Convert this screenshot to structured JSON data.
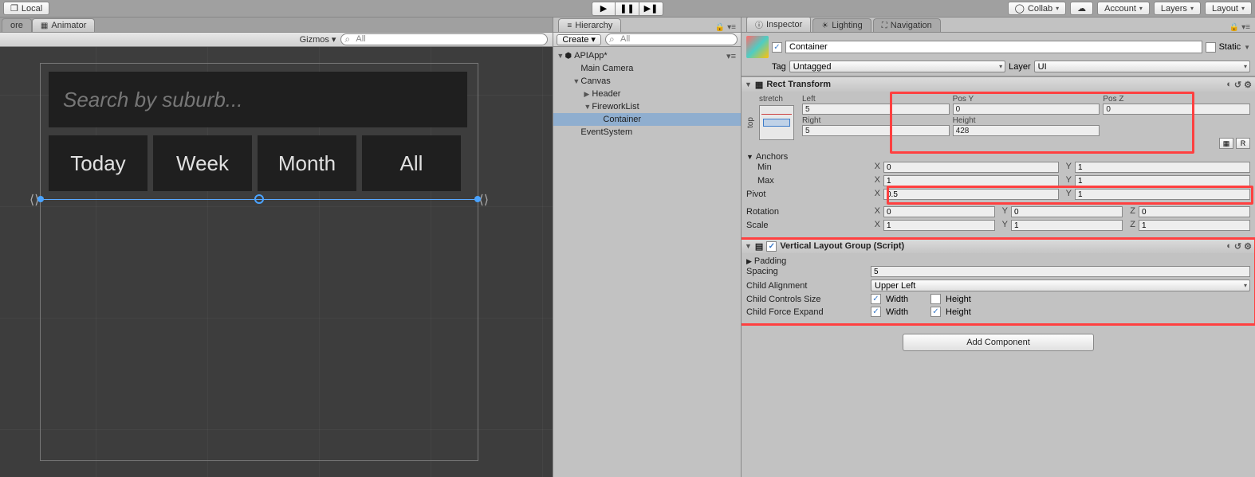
{
  "toolbar": {
    "local": "Local",
    "collab": "Collab",
    "account": "Account",
    "layers": "Layers",
    "layout": "Layout"
  },
  "scene": {
    "tabs": {
      "ore": "ore",
      "animator": "Animator"
    },
    "gizmos": "Gizmos",
    "search_placeholder": "All",
    "mock": {
      "search": "Search by suburb...",
      "btn_today": "Today",
      "btn_week": "Week",
      "btn_month": "Month",
      "btn_all": "All"
    }
  },
  "hierarchy": {
    "tab": "Hierarchy",
    "create": "Create",
    "search_placeholder": "All",
    "root": "APIApp*",
    "nodes": {
      "main_camera": "Main Camera",
      "canvas": "Canvas",
      "header": "Header",
      "fireworklist": "FireworkList",
      "container": "Container",
      "eventsystem": "EventSystem"
    }
  },
  "inspector": {
    "tabs": {
      "inspector": "Inspector",
      "lighting": "Lighting",
      "navigation": "Navigation"
    },
    "go_name": "Container",
    "static": "Static",
    "tag_label": "Tag",
    "tag_value": "Untagged",
    "layer_label": "Layer",
    "layer_value": "UI",
    "rect_transform": {
      "title": "Rect Transform",
      "stretch": "stretch",
      "top": "top",
      "left_label": "Left",
      "left": "5",
      "posy_label": "Pos Y",
      "posy": "0",
      "posz_label": "Pos Z",
      "posz": "0",
      "right_label": "Right",
      "right": "5",
      "height_label": "Height",
      "height": "428",
      "anchors": "Anchors",
      "min": "Min",
      "min_x": "0",
      "min_y": "1",
      "max": "Max",
      "max_x": "1",
      "max_y": "1",
      "pivot": "Pivot",
      "pivot_x": "0.5",
      "pivot_y": "1",
      "rotation": "Rotation",
      "rot_x": "0",
      "rot_y": "0",
      "rot_z": "0",
      "scale": "Scale",
      "scale_x": "1",
      "scale_y": "1",
      "scale_z": "1",
      "r_btn": "R"
    },
    "vlg": {
      "title": "Vertical Layout Group (Script)",
      "padding": "Padding",
      "spacing": "Spacing",
      "spacing_val": "5",
      "child_align": "Child Alignment",
      "child_align_val": "Upper Left",
      "ccs": "Child Controls Size",
      "cfe": "Child Force Expand",
      "width": "Width",
      "height": "Height"
    },
    "add_component": "Add Component"
  }
}
